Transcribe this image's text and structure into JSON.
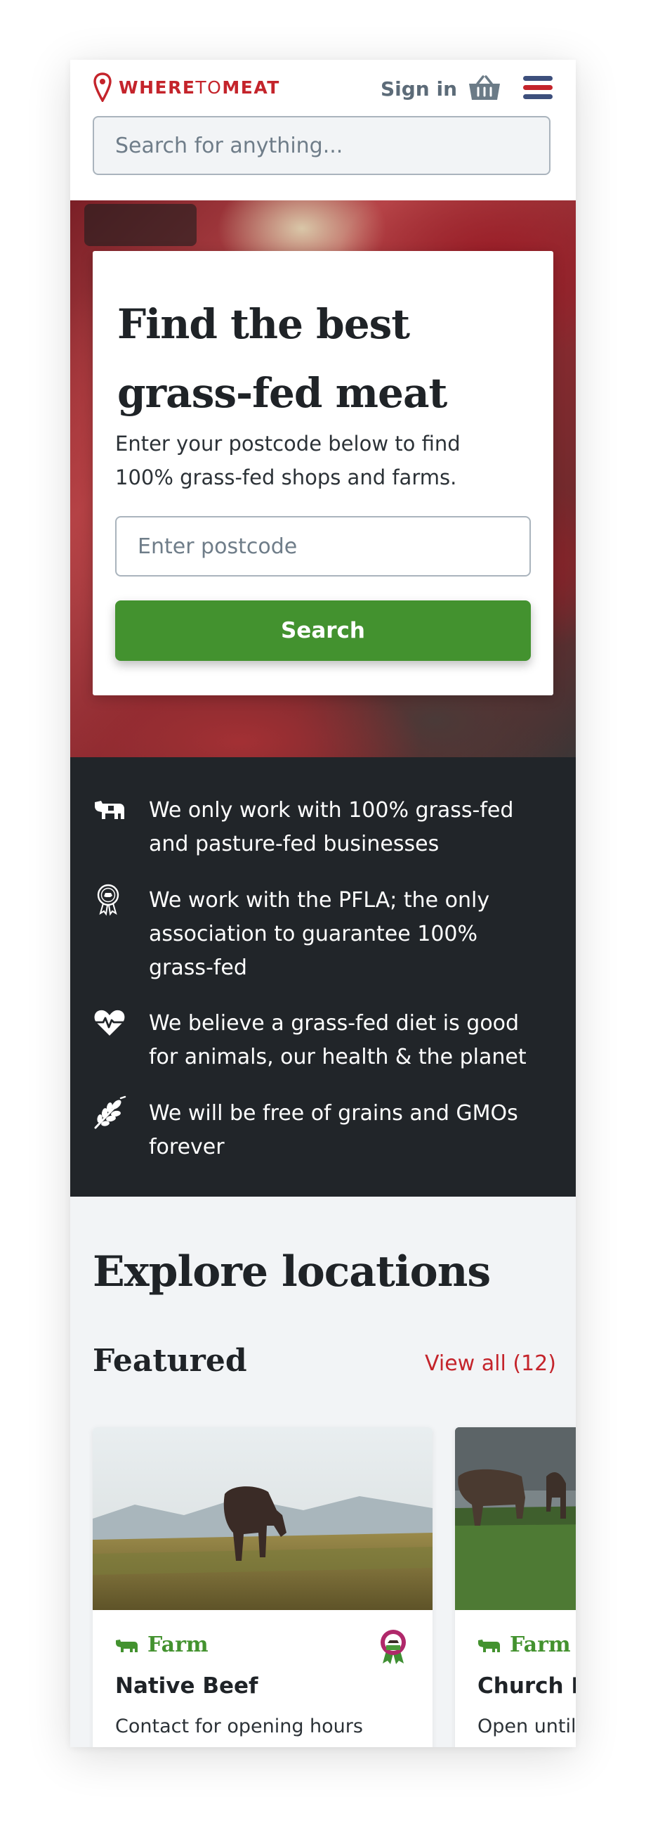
{
  "header": {
    "logo": {
      "part1": "WHERE",
      "part2": "TO",
      "part3": "MEAT"
    },
    "sign_in": "Sign in",
    "search_placeholder": "Search for anything..."
  },
  "hero": {
    "title": "Find the best grass-fed  meat",
    "subtitle": "Enter your postcode below to find 100% grass-fed shops and farms.",
    "postcode_placeholder": "Enter postcode",
    "button": "Search"
  },
  "values": [
    {
      "icon": "cow-icon",
      "text": "We only work with 100% grass-fed and pasture-fed businesses"
    },
    {
      "icon": "pfla-badge-icon",
      "text": "We work with the PFLA; the only association to guarantee 100% grass-fed"
    },
    {
      "icon": "heartbeat-icon",
      "text": "We believe a grass-fed diet is good for animals, our health & the planet"
    },
    {
      "icon": "wheat-icon",
      "text": "We will be free of grains and GMOs forever"
    }
  ],
  "explore": {
    "title": "Explore locations",
    "featured": "Featured",
    "view_all": "View all (12)",
    "cards": [
      {
        "type": "Farm",
        "name": "Native Beef",
        "hours": "Contact for opening hours",
        "badge": "pfla-badge-icon"
      },
      {
        "type": "Farm",
        "name": "Church F",
        "hours": "Open until"
      }
    ]
  },
  "colors": {
    "brand_red": "#c4242b",
    "accent_green": "#43922f",
    "dark_band": "#212529",
    "light_bg": "#f2f4f6"
  }
}
